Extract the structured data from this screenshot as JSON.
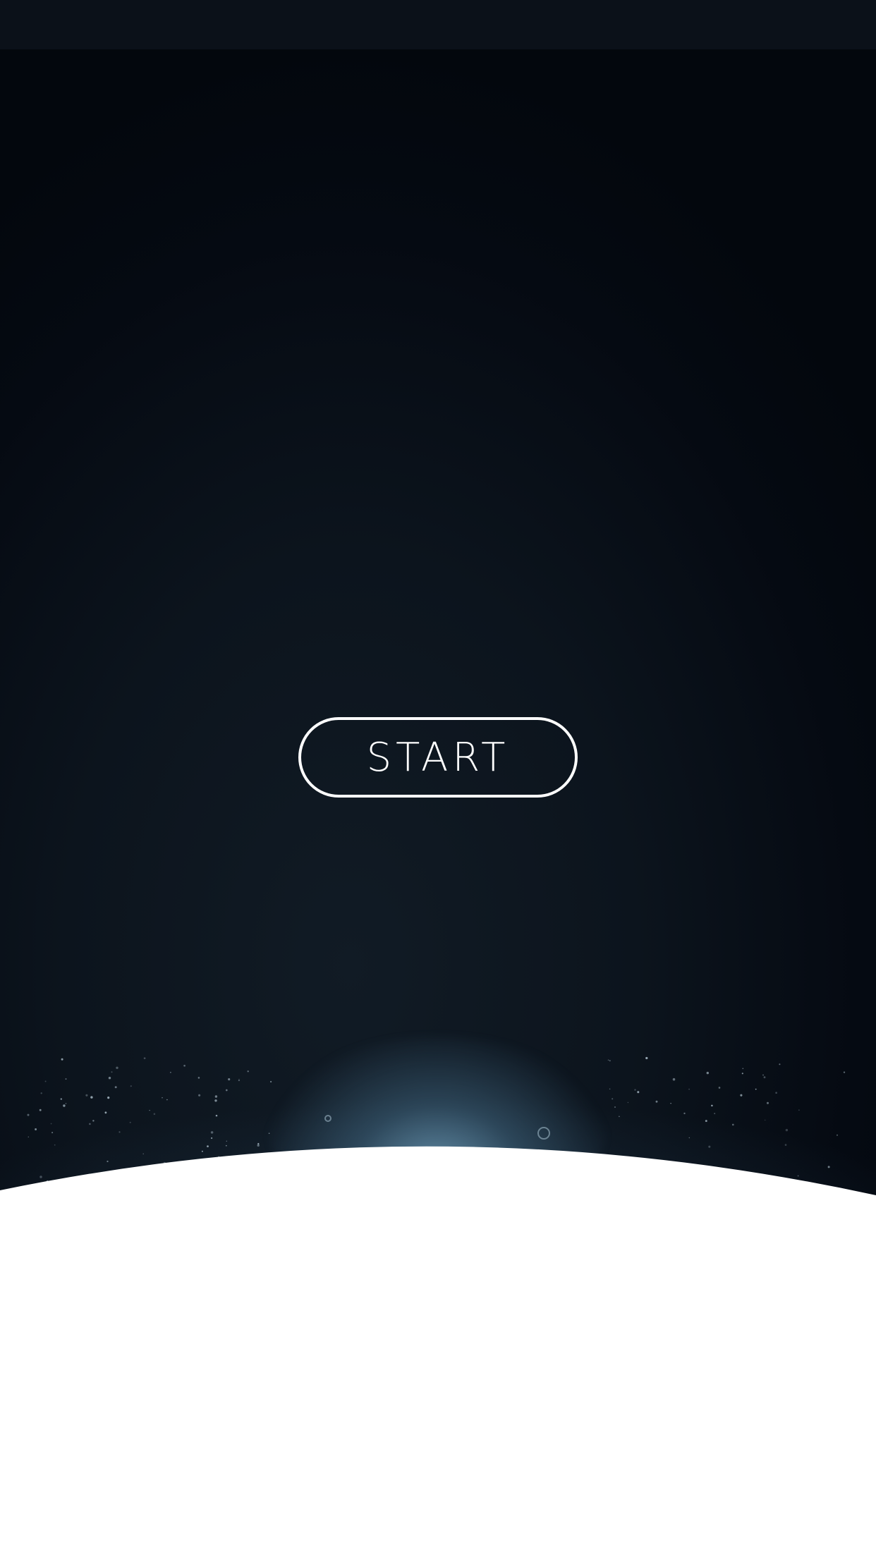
{
  "start_button": {
    "label": "START"
  },
  "colors": {
    "sky_top": "#03070d",
    "sky_mid": "#111b25",
    "glow": "#6ea0be",
    "planet": "#ffffff",
    "button_border": "#ffffff"
  }
}
